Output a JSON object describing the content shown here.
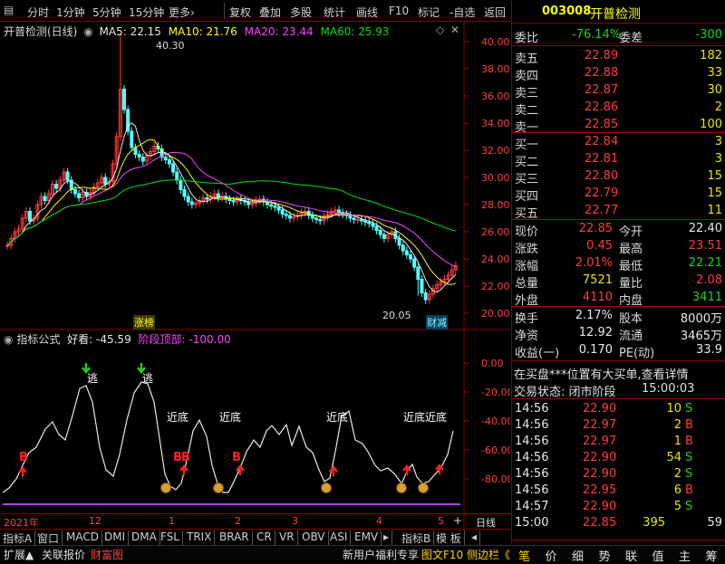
{
  "toolbar": {
    "items": [
      "分时",
      "1分钟",
      "5分钟",
      "15分钟",
      "更多",
      "复权",
      "叠加",
      "多股",
      "统计",
      "画线",
      "F10",
      "标记",
      "-自选",
      "返回"
    ],
    "more_arrow": "›"
  },
  "stock": {
    "code": "003008",
    "name": "开普检测",
    "chart_title": "开普检测(日线)"
  },
  "ma": {
    "ma5": "MA5: 22.15",
    "ma10": "MA10: 21.76",
    "ma20": "MA20: 23.44",
    "ma60": "MA60: 25.93"
  },
  "colors": {
    "up": "#ff3c3c",
    "down": "#54ffff",
    "ma5": "#e8e8e8",
    "ma10": "#ffff00",
    "ma20": "#ff40ff",
    "ma60": "#00e000",
    "frame": "#8a0000",
    "volume_line": "#c040ff"
  },
  "price_axis": {
    "ticks": [
      "40.00",
      "38.00",
      "36.00",
      "34.00",
      "32.00",
      "30.00",
      "28.00",
      "26.00",
      "24.00",
      "22.00",
      "20.00"
    ],
    "max_label": "40.30",
    "min_label": "20.05",
    "tag_left": "涨榜",
    "tag_right": "财减"
  },
  "indicator": {
    "name": "指标公式",
    "good_label": "好看: -45.59",
    "stage_label": "阶段顶部: -100.00",
    "ticks": [
      "0.00",
      "-20.00",
      "-40.00",
      "-60.00",
      "-80.00"
    ],
    "escape": "逃",
    "near_bottom": "近底",
    "buy": "B",
    "bottom_pairs": "近底近底"
  },
  "date_axis": {
    "labels": [
      "2021年",
      "12",
      "1",
      "2",
      "3",
      "4",
      "5"
    ],
    "period": "日线",
    "plus": "+"
  },
  "tabs": {
    "left_label": "指标A",
    "items": [
      "窗口",
      "MACD",
      "DMI",
      "DMA",
      "FSL",
      "TRIX",
      "BRAR",
      "CR",
      "VR",
      "OBV",
      "ASI",
      "EMV"
    ],
    "more": "▸",
    "right_items": [
      "指标B",
      "模 板",
      "◂"
    ]
  },
  "quote": {
    "wei_bi_label": "委比",
    "wei_bi": "-76.14%",
    "wei_cha_label": "委差",
    "wei_cha": "-300",
    "asks": [
      {
        "label": "卖五",
        "price": "22.89",
        "vol": "182"
      },
      {
        "label": "卖四",
        "price": "22.88",
        "vol": "33"
      },
      {
        "label": "卖三",
        "price": "22.87",
        "vol": "30"
      },
      {
        "label": "卖二",
        "price": "22.86",
        "vol": "2"
      },
      {
        "label": "卖一",
        "price": "22.85",
        "vol": "100"
      }
    ],
    "bids": [
      {
        "label": "买一",
        "price": "22.84",
        "vol": "3"
      },
      {
        "label": "买二",
        "price": "22.81",
        "vol": "3"
      },
      {
        "label": "买三",
        "price": "22.80",
        "vol": "15"
      },
      {
        "label": "买四",
        "price": "22.79",
        "vol": "15"
      },
      {
        "label": "买五",
        "price": "22.77",
        "vol": "11"
      }
    ],
    "stats": [
      {
        "l1": "现价",
        "v1": "22.85",
        "l2": "今开",
        "v2": "22.40",
        "c1": "red",
        "c2": "wht"
      },
      {
        "l1": "涨跌",
        "v1": "0.45",
        "l2": "最高",
        "v2": "23.51",
        "c1": "red",
        "c2": "red"
      },
      {
        "l1": "涨幅",
        "v1": "2.01%",
        "l2": "最低",
        "v2": "22.21",
        "c1": "red",
        "c2": "grn"
      },
      {
        "l1": "总量",
        "v1": "7521",
        "l2": "量比",
        "v2": "2.08",
        "c1": "yel",
        "c2": "red"
      },
      {
        "l1": "外盘",
        "v1": "4110",
        "l2": "内盘",
        "v2": "3411",
        "c1": "red",
        "c2": "grn"
      }
    ],
    "stats2": [
      {
        "l1": "换手",
        "v1": "2.17%",
        "l2": "股本",
        "v2": "8000万"
      },
      {
        "l1": "净资",
        "v1": "12.92",
        "l2": "流通",
        "v2": "3465万"
      },
      {
        "l1": "收益(一)",
        "v1": "0.170",
        "l2": "PE(动)",
        "v2": "33.9"
      }
    ],
    "notice": "在买盘***位置有大买单,查看详情",
    "status_label": "交易状态: 闭市阶段",
    "status_time": "15:00:03",
    "trades": [
      {
        "t": "14:56",
        "p": "22.90",
        "v": "10",
        "s": "S"
      },
      {
        "t": "14:56",
        "p": "22.97",
        "v": "2",
        "s": "B"
      },
      {
        "t": "14:56",
        "p": "22.97",
        "v": "1",
        "s": "B"
      },
      {
        "t": "14:56",
        "p": "22.90",
        "v": "54",
        "s": "S"
      },
      {
        "t": "14:56",
        "p": "22.90",
        "v": "2",
        "s": "S"
      },
      {
        "t": "14:56",
        "p": "22.95",
        "v": "6",
        "s": "B"
      },
      {
        "t": "14:57",
        "p": "22.90",
        "v": "5",
        "s": "S"
      },
      {
        "t": "15:00",
        "p": "22.85",
        "v": "395",
        "s": "",
        "cnt": "59"
      }
    ],
    "nav": [
      "笔",
      "价",
      "细",
      "势",
      "联",
      "值",
      "主",
      "筹"
    ]
  },
  "statusbar": {
    "expand": "扩展▲",
    "related": "关联报价",
    "wealth": "财富图",
    "promo": "新用户福利专享",
    "f10": "图文F10",
    "sidebar": "侧边栏《"
  }
}
